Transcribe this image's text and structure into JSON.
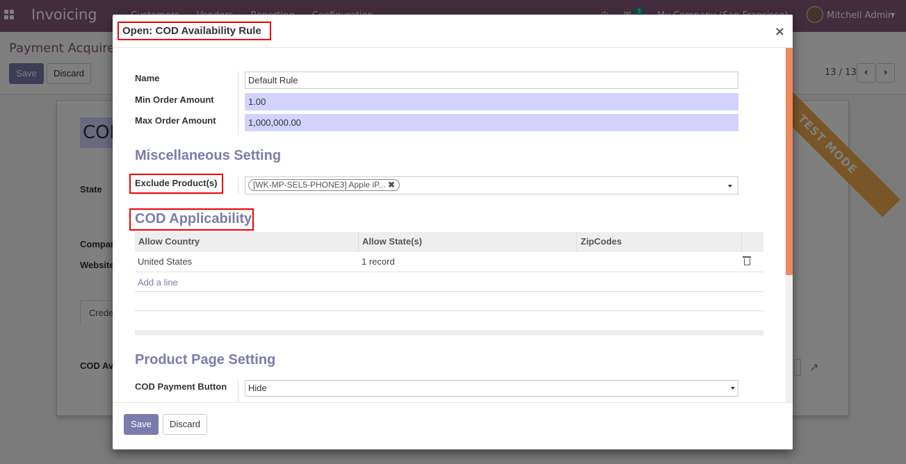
{
  "topbar": {
    "app_name": "Invoicing",
    "menu": [
      "Customers",
      "Vendors",
      "Reporting",
      "Configuration"
    ],
    "chat_count": "3",
    "company": "My Company (San Francisco)",
    "user": "Mitchell Admin"
  },
  "control_panel": {
    "breadcrumb": "Payment Acquirers",
    "save_label": "Save",
    "discard_label": "Discard",
    "pager": "13 / 13"
  },
  "background_form": {
    "title_prefix": "COD",
    "state_label": "State",
    "company_label": "Company",
    "website_label": "Website",
    "tab_label": "Credentials",
    "cod_label": "COD Availability",
    "ribbon": "TEST MODE"
  },
  "modal": {
    "title": "Open: COD Availability Rule",
    "close": "×",
    "fields": {
      "name_label": "Name",
      "name_value": "Default Rule",
      "min_label": "Min Order Amount",
      "min_value": "1.00",
      "max_label": "Max Order Amount",
      "max_value": "1,000,000.00"
    },
    "misc_section": "Miscellaneous Setting",
    "exclude_label": "Exclude Product(s)",
    "exclude_tag": "[WK-MP-SEL5-PHONE3] Apple iP...",
    "applicability_section": "COD Applicability",
    "table": {
      "headers": [
        "Allow Country",
        "Allow State(s)",
        "ZipCodes"
      ],
      "rows": [
        {
          "country": "United States",
          "states": "1 record",
          "zipcodes": ""
        }
      ],
      "add_line": "Add a line"
    },
    "product_section": "Product Page Setting",
    "button_label": "COD Payment Button",
    "button_value": "Hide",
    "footer": {
      "save_label": "Save",
      "discard_label": "Discard"
    }
  },
  "colors": {
    "brand": "#875a7b",
    "primary": "#7c7bad",
    "highlight_box": "#e00000",
    "ribbon": "#f0ad4e"
  }
}
